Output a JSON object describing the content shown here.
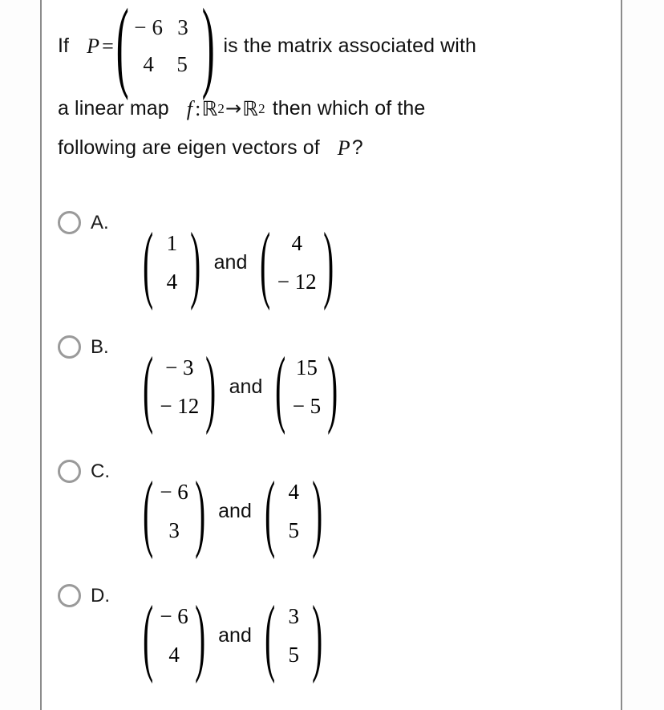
{
  "question": {
    "prefix": "If",
    "matrix_label": "P",
    "equals": "=",
    "matrix": {
      "rows": [
        [
          "− 6",
          "3"
        ],
        [
          "4",
          "5"
        ]
      ]
    },
    "after_matrix": "is the matrix associated with",
    "line2_before": "a linear map",
    "map_function": "f",
    "map_colon": ":",
    "map_domain": "ℝ",
    "map_domain_exp": "2",
    "map_arrow": "→",
    "map_codomain": "ℝ",
    "map_codomain_exp": "2",
    "line2_after": "then which of the",
    "line3_before": "following are eigen vectors of",
    "line3_var": "P",
    "line3_after": "?"
  },
  "options": [
    {
      "letter": "A.",
      "conjunction": "and",
      "vector1": [
        "1",
        "4"
      ],
      "vector2": [
        "4",
        "− 12"
      ]
    },
    {
      "letter": "B.",
      "conjunction": "and",
      "vector1": [
        "− 3",
        "− 12"
      ],
      "vector2": [
        "15",
        "− 5"
      ]
    },
    {
      "letter": "C.",
      "conjunction": "and",
      "vector1": [
        "− 6",
        "3"
      ],
      "vector2": [
        "4",
        "5"
      ]
    },
    {
      "letter": "D.",
      "conjunction": "and",
      "vector1": [
        "− 6",
        "4"
      ],
      "vector2": [
        "3",
        "5"
      ]
    }
  ],
  "colors": {
    "rule": "#8c8c8c",
    "radio_border": "#9a9a9a",
    "text": "#111111",
    "page_background": "#ffffff"
  }
}
